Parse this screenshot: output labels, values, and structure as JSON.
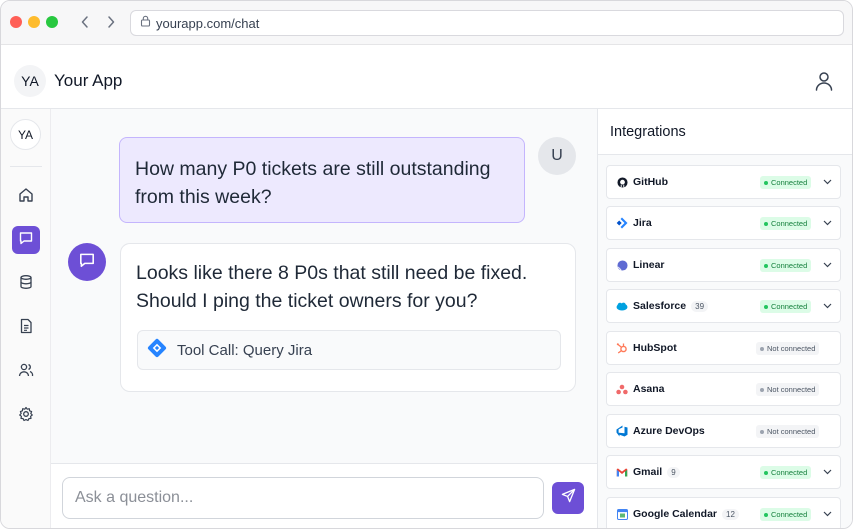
{
  "browser": {
    "url": "yourapp.com/chat"
  },
  "header": {
    "logo_initials": "YA",
    "app_title": "Your App"
  },
  "sidebar": {
    "avatar_initials": "YA",
    "items": [
      {
        "name": "home",
        "icon": "home-icon"
      },
      {
        "name": "chat",
        "icon": "chat-icon",
        "active": true
      },
      {
        "name": "database",
        "icon": "database-icon"
      },
      {
        "name": "documents",
        "icon": "document-icon"
      },
      {
        "name": "users",
        "icon": "users-icon"
      },
      {
        "name": "settings",
        "icon": "gear-icon"
      }
    ]
  },
  "chat": {
    "user_avatar": "U",
    "user_message": "How many P0 tickets are still outstanding from this week?",
    "assistant_message": "Looks like there 8 P0s that still need be fixed. Should I ping the ticket owners for you?",
    "tool_call_label": "Tool Call: Query Jira"
  },
  "composer": {
    "placeholder": "Ask a question..."
  },
  "integrations": {
    "title": "Integrations",
    "items": [
      {
        "name": "GitHub",
        "status": "Connected",
        "count": "",
        "expandable": true,
        "color": "#111827"
      },
      {
        "name": "Jira",
        "status": "Connected",
        "count": "",
        "expandable": true,
        "color": "#2684ff"
      },
      {
        "name": "Linear",
        "status": "Connected",
        "count": "",
        "expandable": true,
        "color": "#5e6ad2"
      },
      {
        "name": "Salesforce",
        "status": "Connected",
        "count": "39",
        "expandable": true,
        "color": "#00a1e0"
      },
      {
        "name": "HubSpot",
        "status": "Not connected",
        "count": "",
        "expandable": false,
        "color": "#ff7a59"
      },
      {
        "name": "Asana",
        "status": "Not connected",
        "count": "",
        "expandable": false,
        "color": "#f06a6a"
      },
      {
        "name": "Azure DevOps",
        "status": "Not connected",
        "count": "",
        "expandable": false,
        "color": "#0078d4"
      },
      {
        "name": "Gmail",
        "status": "Connected",
        "count": "9",
        "expandable": true,
        "color": "#ea4335"
      },
      {
        "name": "Google Calendar",
        "status": "Connected",
        "count": "12",
        "expandable": true,
        "color": "#4285f4"
      }
    ]
  },
  "colors": {
    "accent": "#6d4fd6",
    "user_bubble": "#ede9fe",
    "connected_bg": "#dcfce7",
    "connected_text": "#15803d"
  }
}
